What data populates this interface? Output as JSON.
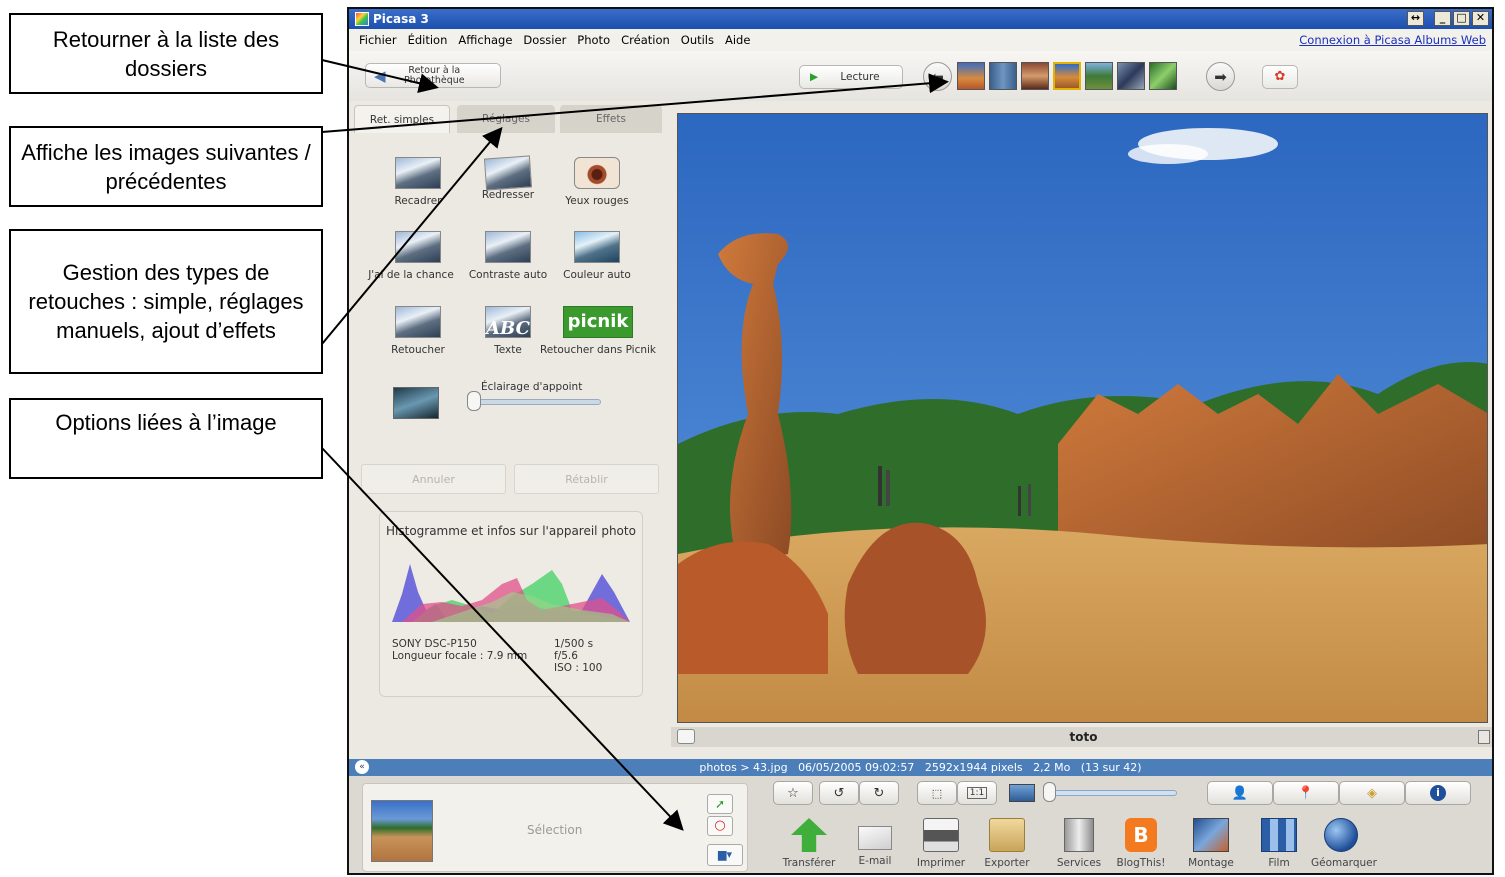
{
  "callouts": {
    "c1": "Retourner à la liste des dossiers",
    "c2": "Affiche les images suivantes / précédentes",
    "c3": "Gestion des types de retouches : simple, réglages manuels, ajout d’effets",
    "c4": "Options liées à l’image"
  },
  "window": {
    "title": "Picasa 3",
    "menu": [
      "Fichier",
      "Édition",
      "Affichage",
      "Dossier",
      "Photo",
      "Création",
      "Outils",
      "Aide"
    ],
    "web_link": "Connexion à Picasa Albums Web"
  },
  "toolbar": {
    "back_line1": "Retour à la",
    "back_line2": "Photothèque",
    "play_label": "Lecture"
  },
  "tabs": [
    "Ret. simples",
    "Réglages",
    "Effets"
  ],
  "tools": {
    "recadrer": "Recadrer",
    "redresser": "Redresser",
    "yeux_rouges": "Yeux rouges",
    "jai_de_la_chance": "J'ai de la chance",
    "contraste_auto": "Contraste auto",
    "couleur_auto": "Couleur auto",
    "retoucher": "Retoucher",
    "texte": "Texte",
    "picnik": "Retoucher dans Picnik",
    "picnik_logo": "picnik",
    "texte_icon": "ABC",
    "eclairage": "Éclairage d'appoint"
  },
  "actions": {
    "annuler": "Annuler",
    "retablir": "Rétablir"
  },
  "histogram": {
    "title": "Histogramme et infos sur l'appareil photo",
    "camera": "SONY DSC-P150",
    "focal": "Longueur focale : 7.9 mm",
    "shutter": "1/500 s",
    "aperture": "f/5.6",
    "iso": "ISO : 100"
  },
  "caption": "toto",
  "status": "photos > 43.jpg   06/05/2005 09:02:57   2592x1944 pixels   2,2 Mo   (13 sur 42)",
  "tray": {
    "selection_label": "Sélection"
  },
  "bottom_buttons": [
    "Transférer",
    "E-mail",
    "Imprimer",
    "Exporter",
    "Services",
    "BlogThis!",
    "Montage",
    "Film",
    "Géomarquer"
  ],
  "size_buttons": {
    "one_to_one": "1:1"
  },
  "colors": {
    "sky": "#2f6fc6",
    "status_bar": "#4c7fba",
    "title_bar": "#2457b8"
  }
}
